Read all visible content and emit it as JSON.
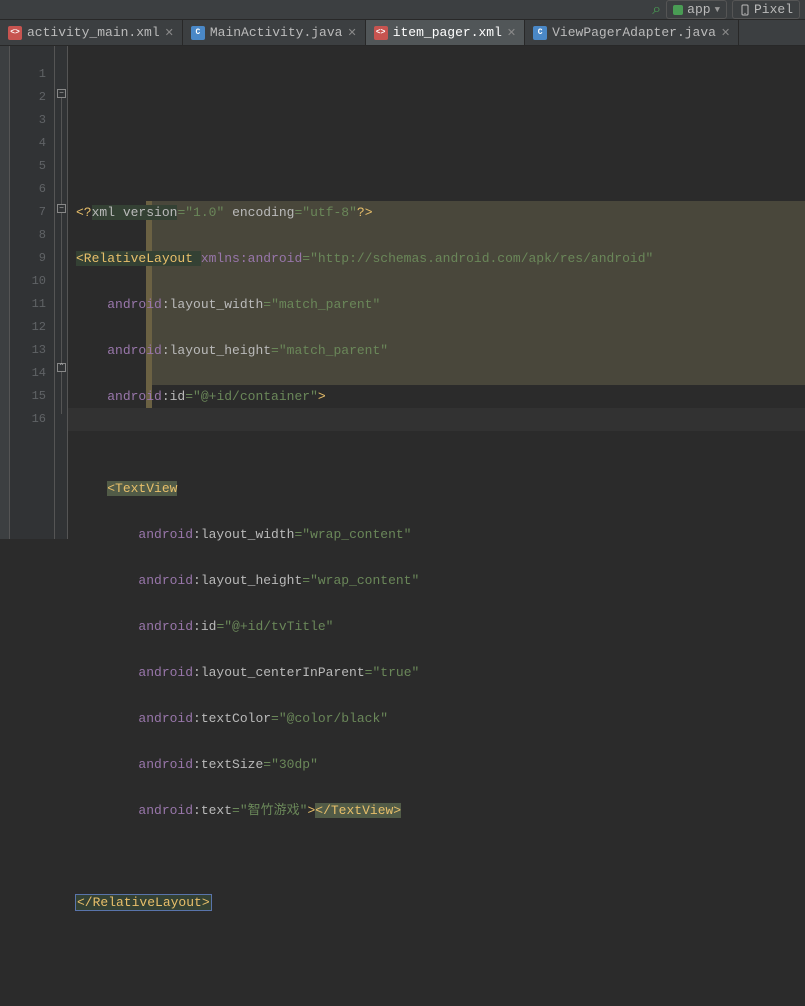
{
  "toolbar": {
    "module": "app",
    "pixel": "Pixel"
  },
  "tabs": [
    {
      "icon": "orange",
      "iconText": "<>",
      "label": "activity_main.xml",
      "active": false
    },
    {
      "icon": "blue",
      "iconText": "C",
      "label": "MainActivity.java",
      "active": false
    },
    {
      "icon": "orange",
      "iconText": "<>",
      "label": "item_pager.xml",
      "active": true
    },
    {
      "icon": "blue",
      "iconText": "C",
      "label": "ViewPagerAdapter.java",
      "active": false
    }
  ],
  "lines": [
    "1",
    "2",
    "3",
    "4",
    "5",
    "6",
    "7",
    "8",
    "9",
    "10",
    "11",
    "12",
    "13",
    "14",
    "15",
    "16"
  ],
  "code": {
    "l1": {
      "a": "<?",
      "b": "xml version",
      "c": "=",
      "d": "\"1.0\"",
      "e": " encoding",
      "f": "=",
      "g": "\"utf-8\"",
      "h": "?>"
    },
    "l2": {
      "a": "<RelativeLayout ",
      "b": "xmlns:",
      "c": "android",
      "d": "=",
      "e": "\"http://schemas.android.com/apk/res/android\""
    },
    "l3": {
      "a": "android",
      "b": ":layout_width",
      "c": "=",
      "d": "\"match_parent\""
    },
    "l4": {
      "a": "android",
      "b": ":layout_height",
      "c": "=",
      "d": "\"match_parent\""
    },
    "l5": {
      "a": "android",
      "b": ":id",
      "c": "=",
      "d": "\"@+id/container\"",
      "e": ">"
    },
    "l7": {
      "a": "<TextView"
    },
    "l8": {
      "a": "android",
      "b": ":layout_width",
      "c": "=",
      "d": "\"wrap_content\""
    },
    "l9": {
      "a": "android",
      "b": ":layout_height",
      "c": "=",
      "d": "\"wrap_content\""
    },
    "l10": {
      "a": "android",
      "b": ":id",
      "c": "=",
      "d": "\"@+id/tvTitle\""
    },
    "l11": {
      "a": "android",
      "b": ":layout_centerInParent",
      "c": "=",
      "d": "\"true\""
    },
    "l12": {
      "a": "android",
      "b": ":textColor",
      "c": "=",
      "d": "\"@color/black\""
    },
    "l13": {
      "a": "android",
      "b": ":textSize",
      "c": "=",
      "d": "\"30dp\""
    },
    "l14": {
      "a": "android",
      "b": ":text",
      "c": "=",
      "d": "\"智竹游戏\"",
      "e": ">",
      "f": "</TextView>"
    },
    "l16": {
      "a": "</RelativeLayout>"
    }
  }
}
